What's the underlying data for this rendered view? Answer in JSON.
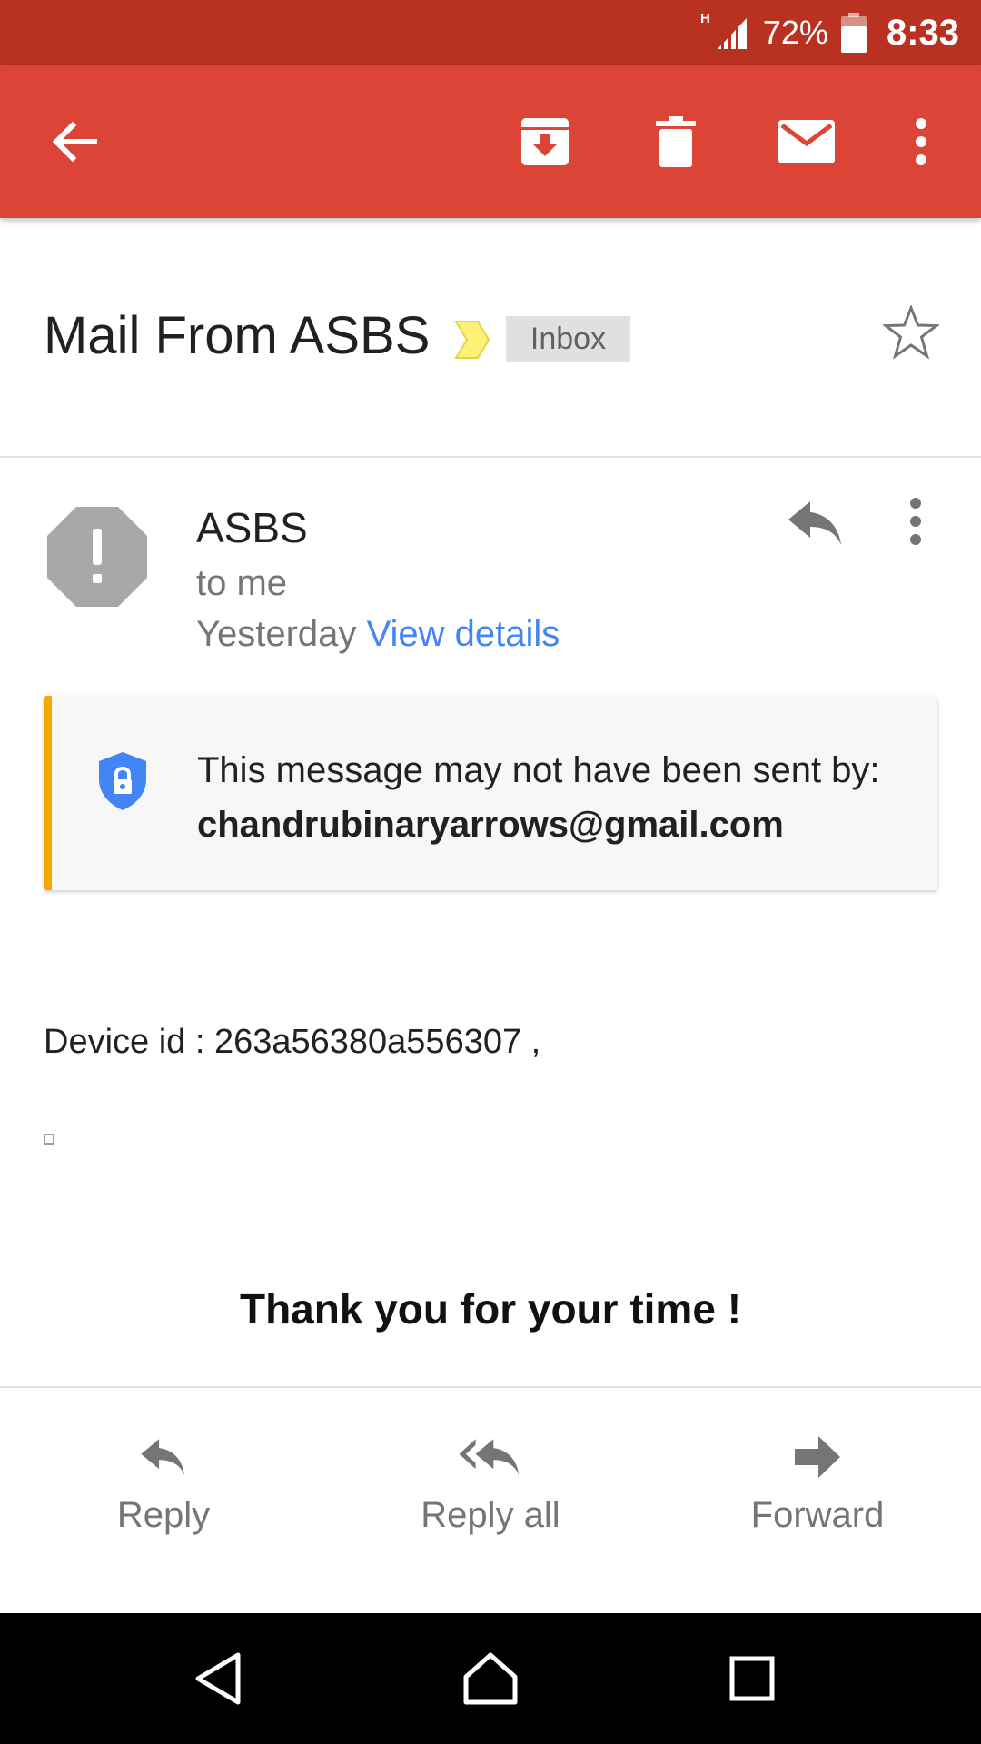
{
  "status_bar": {
    "network_type": "H",
    "battery_percent": "72%",
    "time": "8:33",
    "icons": [
      "signal-icon",
      "battery-icon"
    ]
  },
  "toolbar": {
    "icons": [
      "back-arrow-icon",
      "archive-icon",
      "delete-icon",
      "mark-unread-icon",
      "more-vert-icon"
    ]
  },
  "email": {
    "subject": "Mail From ASBS",
    "label": "Inbox",
    "sender": "ASBS",
    "recipient": "to me",
    "date": "Yesterday",
    "view_details": "View details",
    "warning": {
      "text": "This message may not have been sent by:",
      "address": "chandrubinaryarrows@gmail.com"
    },
    "body": {
      "device_line": "Device id : 263a56380a556307 ,",
      "closing": "Thank you for your time !"
    }
  },
  "bottom_actions": {
    "reply": "Reply",
    "reply_all": "Reply all",
    "forward": "Forward"
  },
  "colors": {
    "status_bar": "#b93221",
    "action_bar": "#db4437",
    "link": "#4285f4",
    "warning_accent": "#f6a800",
    "label_chip": "#e0e0e0"
  }
}
